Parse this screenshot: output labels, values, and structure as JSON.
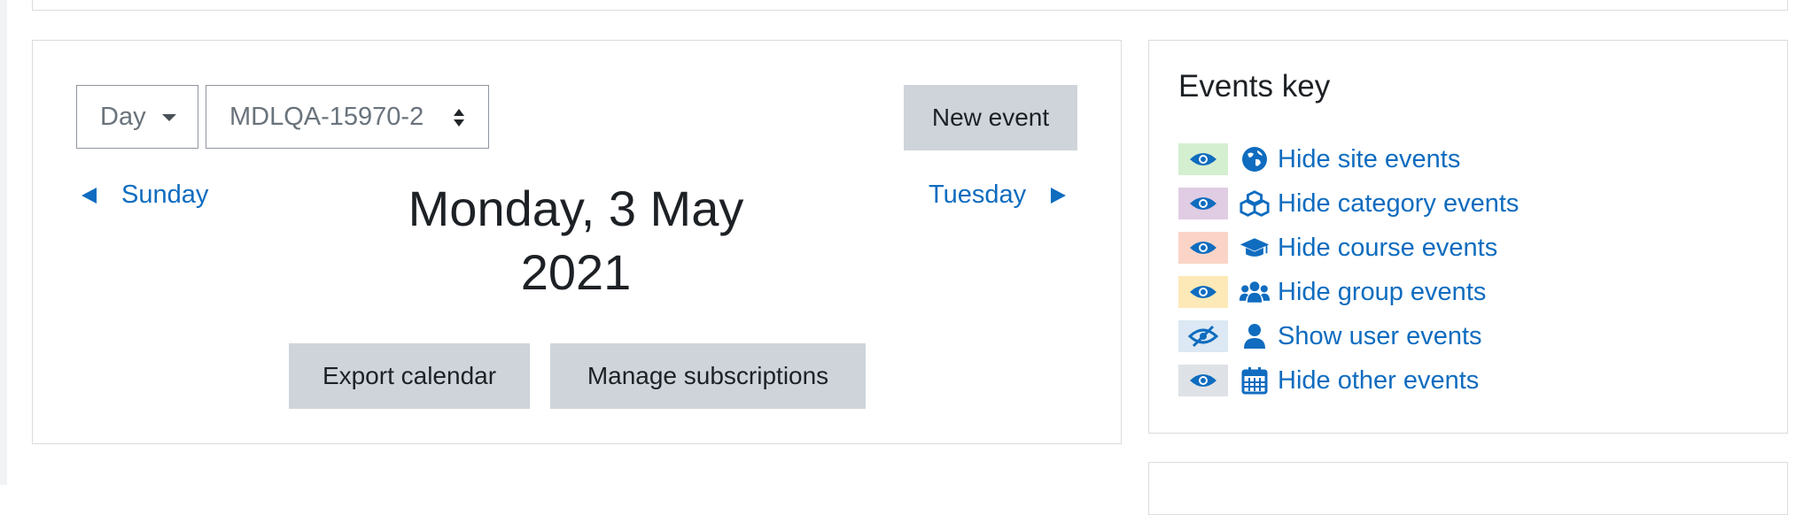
{
  "calendar": {
    "view_select": "Day",
    "course_select": "MDLQA-15970-2",
    "new_event": "New event",
    "prev_day": "Sunday",
    "next_day": "Tuesday",
    "title_line1": "Monday, 3 May",
    "title_line2": "2021",
    "export": "Export calendar",
    "manage": "Manage subscriptions"
  },
  "events_key": {
    "title": "Events key",
    "items": [
      {
        "label": "Hide site events",
        "color": "#d4eed0",
        "eye": "eye-icon",
        "icon": "globe-icon"
      },
      {
        "label": "Hide category events",
        "color": "#e0cce3",
        "eye": "eye-icon",
        "icon": "cubes-icon"
      },
      {
        "label": "Hide course events",
        "color": "#fbd4c7",
        "eye": "eye-icon",
        "icon": "graduation-cap-icon"
      },
      {
        "label": "Hide group events",
        "color": "#fde9b8",
        "eye": "eye-icon",
        "icon": "users-icon"
      },
      {
        "label": "Show user events",
        "color": "#dce8f3",
        "eye": "eye-slash-icon",
        "icon": "user-icon"
      },
      {
        "label": "Hide other events",
        "color": "#dee2e6",
        "eye": "eye-icon",
        "icon": "calendar-icon"
      }
    ]
  },
  "colors": {
    "link": "#0f6cbf",
    "button": "#ced4da"
  }
}
